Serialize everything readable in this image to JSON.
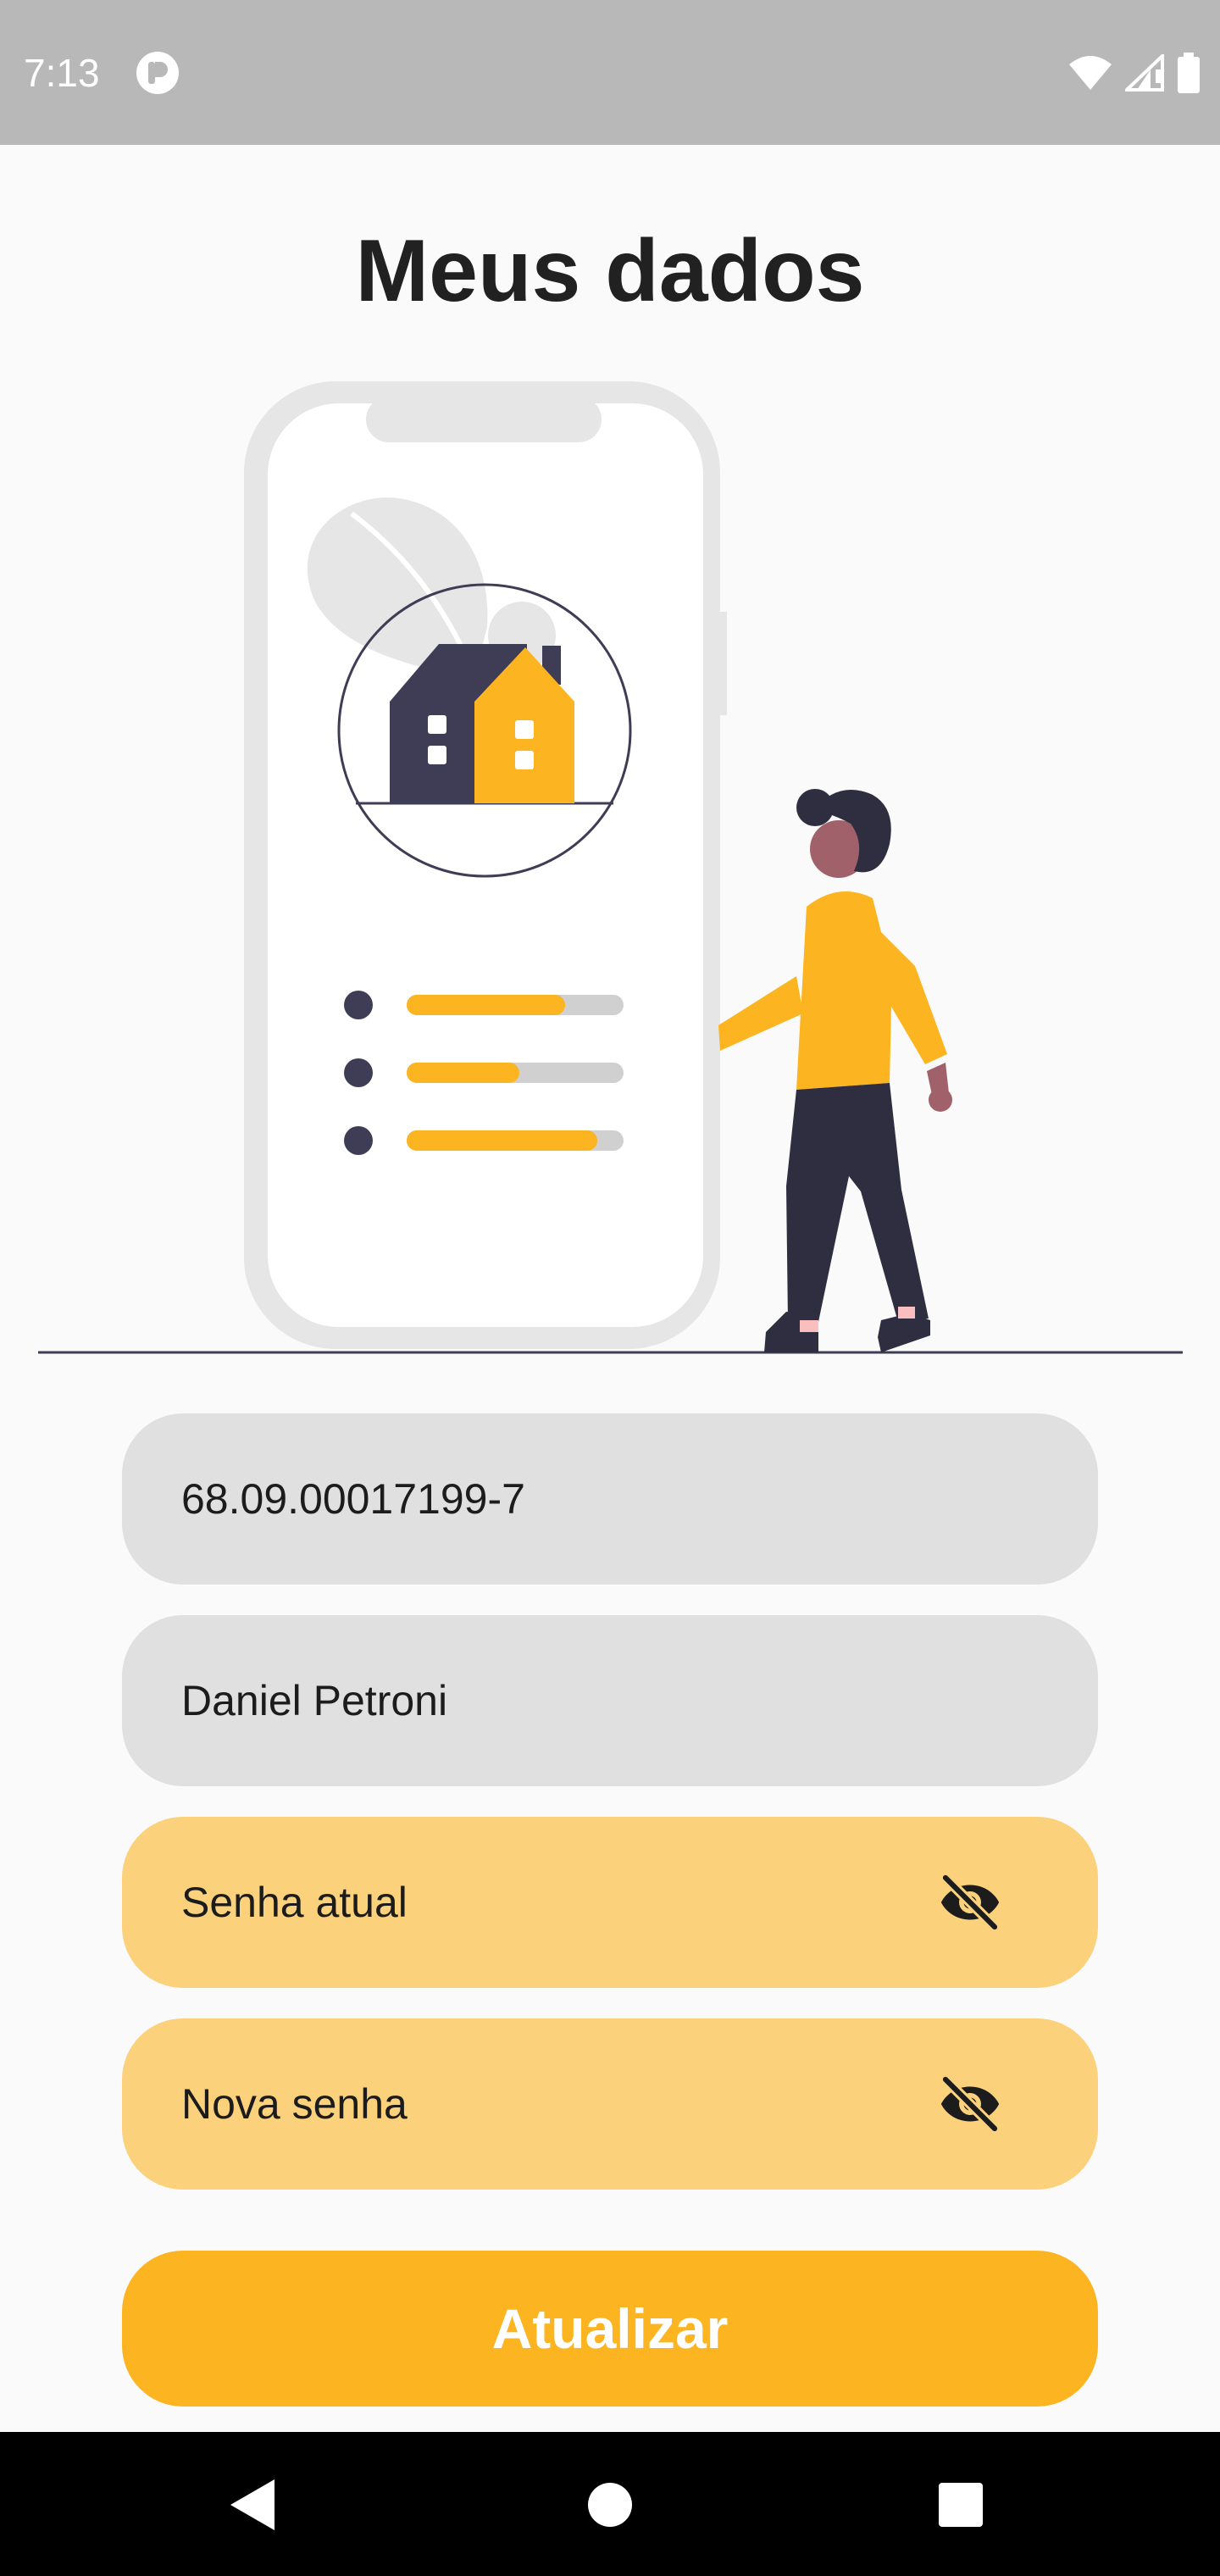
{
  "status_bar": {
    "time": "7:13",
    "icons": [
      "app-notification-icon",
      "wifi-icon",
      "signal-icon",
      "battery-icon"
    ]
  },
  "page": {
    "title": "Meus dados"
  },
  "illustration": {
    "description_icon": "house-app-illustration",
    "progress_levels": [
      0.73,
      0.52,
      0.88
    ]
  },
  "form": {
    "account_field": {
      "value": "68.09.00017199-7"
    },
    "name_field": {
      "value": "Daniel Petroni"
    },
    "current_password": {
      "placeholder": "Senha atual",
      "icon": "eye-off-icon"
    },
    "new_password": {
      "placeholder": "Nova senha",
      "icon": "eye-off-icon"
    },
    "submit_label": "Atualizar"
  },
  "nav_bar": {
    "buttons": [
      "back-icon",
      "home-icon",
      "recents-icon"
    ]
  },
  "colors": {
    "accent": "#fcb420",
    "password_field_bg": "#fbd17c",
    "readonly_field_bg": "#e0e0e0",
    "dark_navy": "#3f3d56",
    "skin": "#a0616a",
    "status_bar_bg": "#b8b8b8"
  }
}
